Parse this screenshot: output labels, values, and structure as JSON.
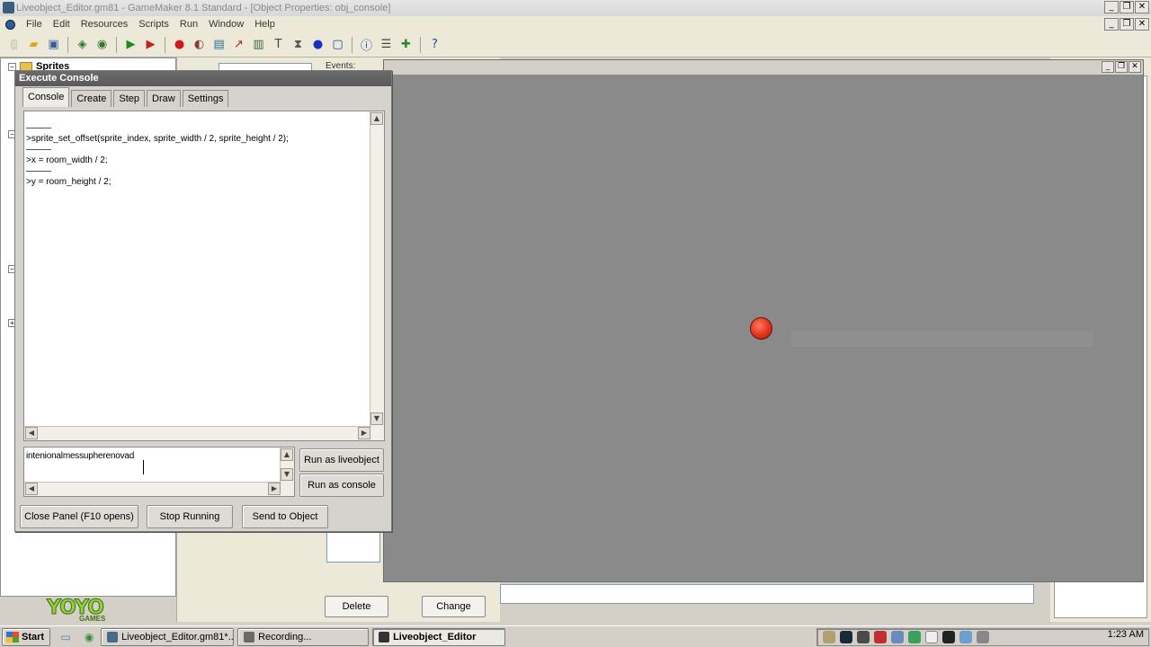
{
  "window": {
    "title": "Liveobject_Editor.gm81 - GameMaker 8.1 Standard - [Object Properties: obj_console]",
    "controls": [
      "_",
      "❐",
      "✕"
    ]
  },
  "menu": {
    "items": [
      "File",
      "Edit",
      "Resources",
      "Scripts",
      "Run",
      "Window",
      "Help"
    ]
  },
  "toolbar": {
    "icons": [
      "new-file-icon",
      "open-folder-icon",
      "save-icon",
      "publish-icon",
      "globe-icon",
      "run-icon",
      "debug-run-icon",
      "create-sprite-icon",
      "create-sound-icon",
      "create-background-icon",
      "create-path-icon",
      "create-script-icon",
      "create-font-icon",
      "create-timeline-icon",
      "create-object-icon",
      "create-room-icon",
      "game-info-icon",
      "global-settings-icon",
      "extensions-icon",
      "help-icon"
    ]
  },
  "tree": {
    "sprites_label": "Sprites"
  },
  "background": {
    "events_label": "Events:",
    "delete_label": "Delete",
    "change_label": "Change"
  },
  "console": {
    "title": "Execute Console",
    "tabs": [
      "Console",
      "Create",
      "Step",
      "Draw",
      "Settings"
    ],
    "active_tab": "Console",
    "output_lines": [
      ">sprite_set_offset(sprite_index, sprite_width / 2, sprite_height / 2);",
      ">x = room_width / 2;",
      ">y = room_height / 2;"
    ],
    "input_value": "intenionalmessupherenovad",
    "run_liveobject_label": "Run as liveobject",
    "run_console_label": "Run as console",
    "close_panel_label": "Close Panel (F10 opens)",
    "stop_running_label": "Stop Running",
    "send_to_object_label": "Send to Object"
  },
  "logo": {
    "main": "YOYO",
    "sub": "GAMES"
  },
  "taskbar": {
    "start_label": "Start",
    "tasks": [
      {
        "label": "Liveobject_Editor.gm81*...",
        "active": false
      },
      {
        "label": "Recording...",
        "active": false
      },
      {
        "label": "Liveobject_Editor",
        "active": true
      }
    ],
    "clock": "1:23 AM"
  },
  "colors": {
    "room_background": "#8a8a8a",
    "ball": "#e0331d",
    "console_title": "#5f5f5f"
  }
}
